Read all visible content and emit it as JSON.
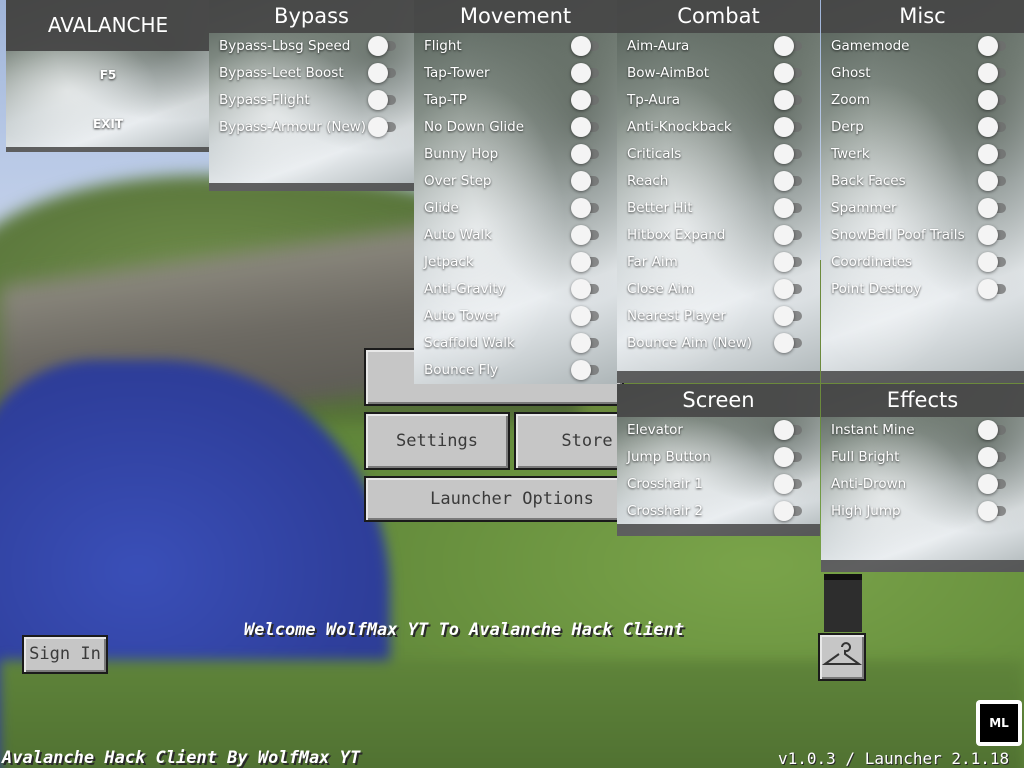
{
  "menu": {
    "title": "AVALANCHE",
    "buttons": [
      "F5",
      "EXIT"
    ]
  },
  "panels": {
    "bypass": {
      "title": "Bypass",
      "items": [
        "Bypass-Lbsg Speed",
        "Bypass-Leet Boost",
        "Bypass-Flight",
        "Bypass-Armour (New)"
      ]
    },
    "movement": {
      "title": "Movement",
      "items": [
        "Flight",
        "Tap-Tower",
        "Tap-TP",
        "No Down Glide",
        "Bunny Hop",
        "Over Step",
        "Glide",
        "Auto Walk",
        "Jetpack",
        "Anti-Gravity",
        "Auto Tower",
        "Scaffold Walk",
        "Bounce Fly"
      ]
    },
    "combat": {
      "title": "Combat",
      "items": [
        "Aim-Aura",
        "Bow-AimBot",
        "Tp-Aura",
        "Anti-Knockback",
        "Criticals",
        "Reach",
        "Better Hit",
        "Hitbox Expand",
        "Far Aim",
        "Close Aim",
        "Nearest Player",
        "Bounce Aim (New)"
      ]
    },
    "misc": {
      "title": "Misc",
      "items": [
        "Gamemode",
        "Ghost",
        "Zoom",
        "Derp",
        "Twerk",
        "Back Faces",
        "Spammer",
        "SnowBall Poof Trails",
        "Coordinates",
        "Point Destroy"
      ]
    },
    "screen": {
      "title": "Screen",
      "items": [
        "Elevator",
        "Jump Button",
        "Crosshair 1",
        "Crosshair 2"
      ]
    },
    "effects": {
      "title": "Effects",
      "items": [
        "Instant Mine",
        "Full Bright",
        "Anti-Drown",
        "High Jump"
      ]
    }
  },
  "mc": {
    "settings": "Settings",
    "store": "Store",
    "launcher_options": "Launcher Options",
    "sign_in": "Sign In",
    "welcome": "Welcome WolfMax YT To Avalanche Hack Client",
    "footer_left": "Avalanche Hack Client By WolfMax YT",
    "footer_right": "v1.0.3 / Launcher 2.1.18",
    "ml_badge": "ML",
    "hanger_icon": "hanger-icon"
  },
  "colors": {
    "panel_header": "#464646",
    "toggle_off_track": "#6e6e6e",
    "toggle_knob": "#f4f4f4",
    "mc_button": "#c6c6c6"
  }
}
